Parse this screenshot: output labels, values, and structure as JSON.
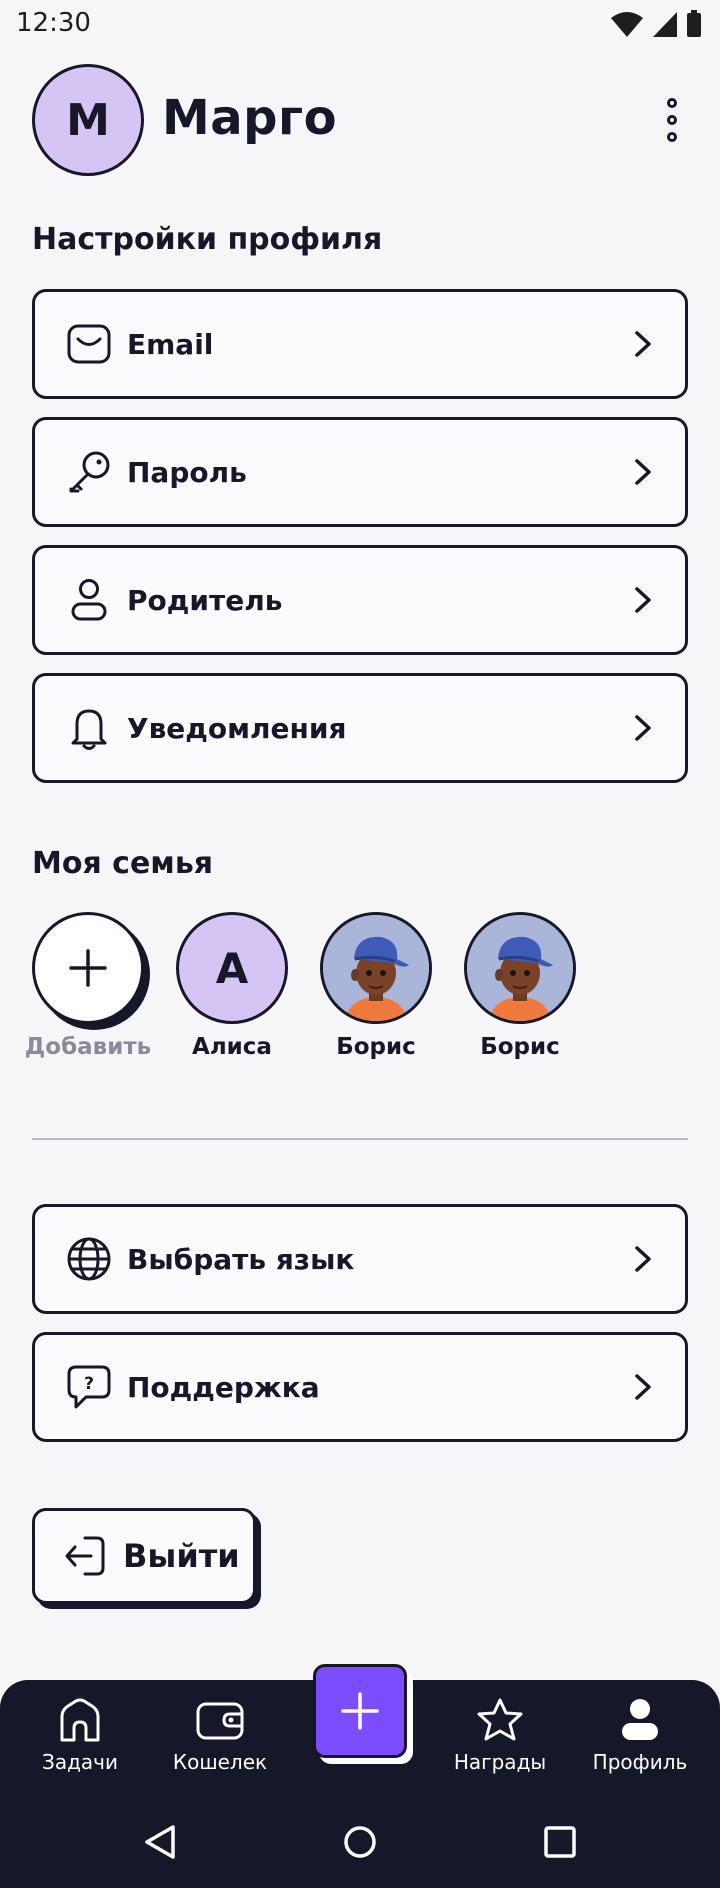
{
  "status_bar": {
    "time": "12:30"
  },
  "header": {
    "avatar_letter": "М",
    "name": "Марго"
  },
  "profile_settings": {
    "title": "Настройки профиля",
    "items": [
      {
        "label": "Email",
        "icon": "mail-icon"
      },
      {
        "label": "Пароль",
        "icon": "key-icon"
      },
      {
        "label": "Родитель",
        "icon": "person-icon"
      },
      {
        "label": "Уведомления",
        "icon": "bell-icon"
      }
    ]
  },
  "family": {
    "title": "Моя семья",
    "add_label": "Добавить",
    "members": [
      {
        "name": "Алиса",
        "letter": "А"
      },
      {
        "name": "Борис"
      },
      {
        "name": "Борис"
      }
    ]
  },
  "other_settings": {
    "items": [
      {
        "label": "Выбрать язык",
        "icon": "globe-icon"
      },
      {
        "label": "Поддержка",
        "icon": "support-chat-icon"
      }
    ]
  },
  "logout": {
    "label": "Выйти"
  },
  "tabbar": {
    "tabs": [
      {
        "label": "Задачи",
        "icon": "home-icon"
      },
      {
        "label": "Кошелек",
        "icon": "wallet-icon"
      },
      {
        "label": "Награды",
        "icon": "star-icon"
      },
      {
        "label": "Профиль",
        "icon": "profile-icon"
      }
    ],
    "active": "Профиль",
    "fab_icon": "plus-icon"
  },
  "colors": {
    "accent": "#7c4dff",
    "dark": "#17172a",
    "avatar_bg": "#d4c5f5",
    "background": "#f6f6f9"
  }
}
